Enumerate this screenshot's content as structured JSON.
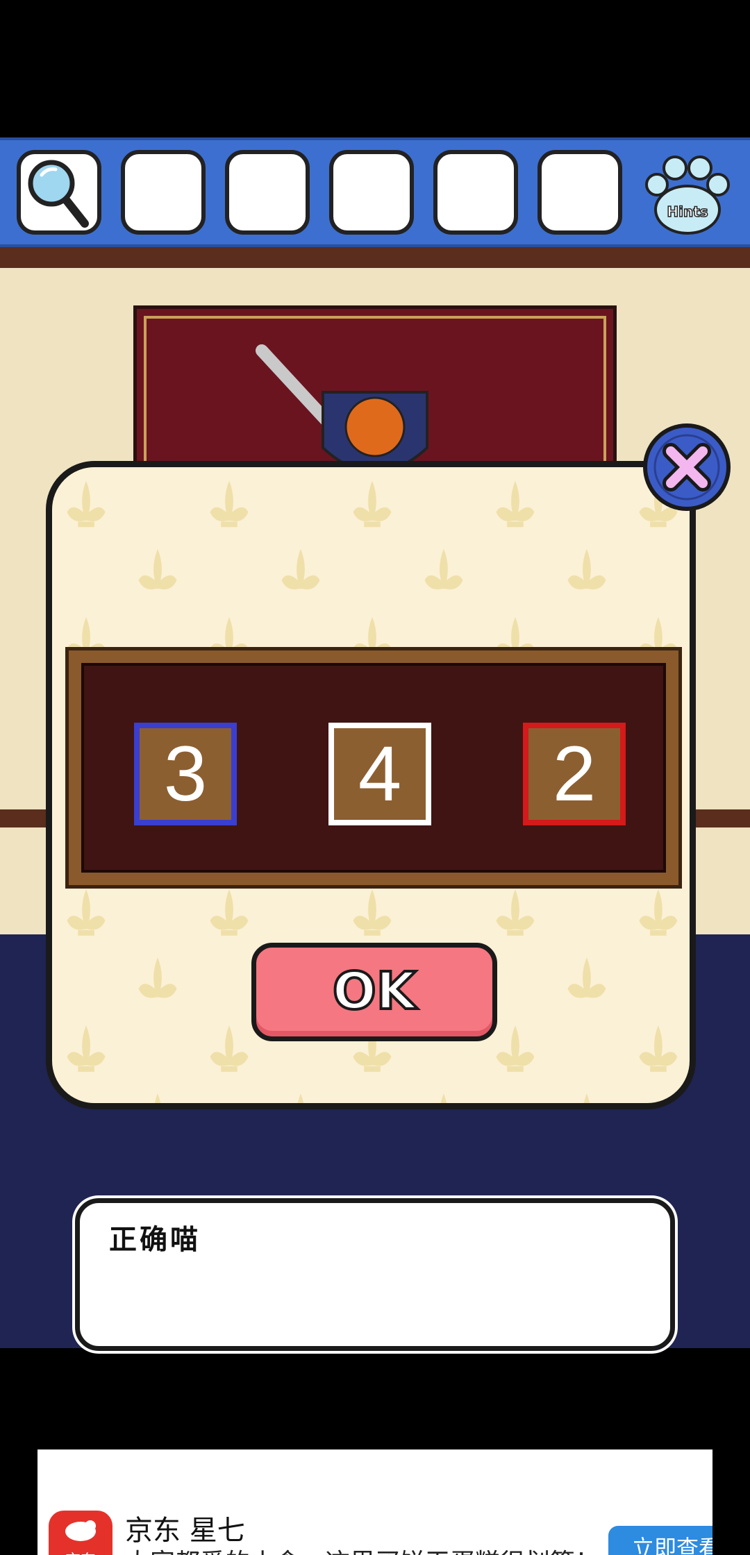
{
  "inventory": {
    "slots": [
      {
        "item": "magnifier-icon"
      },
      {
        "item": ""
      },
      {
        "item": ""
      },
      {
        "item": ""
      },
      {
        "item": ""
      },
      {
        "item": ""
      }
    ],
    "hint_label": "Hints",
    "bar_color": "#3d6fd0"
  },
  "puzzle": {
    "digits": [
      {
        "value": "3",
        "frame_color": "#3a3fd0"
      },
      {
        "value": "4",
        "frame_color": "#ffffff"
      },
      {
        "value": "2",
        "frame_color": "#d41a1a"
      }
    ],
    "ok_label": "OK",
    "close_icon": "close-x-icon"
  },
  "message": {
    "text": "正确喵"
  },
  "ad": {
    "logo_text": "京东",
    "title": "京东 星七",
    "description": "大家都爱的小食，这里买饼干蛋糕很划算！",
    "cta": "立即查看"
  }
}
